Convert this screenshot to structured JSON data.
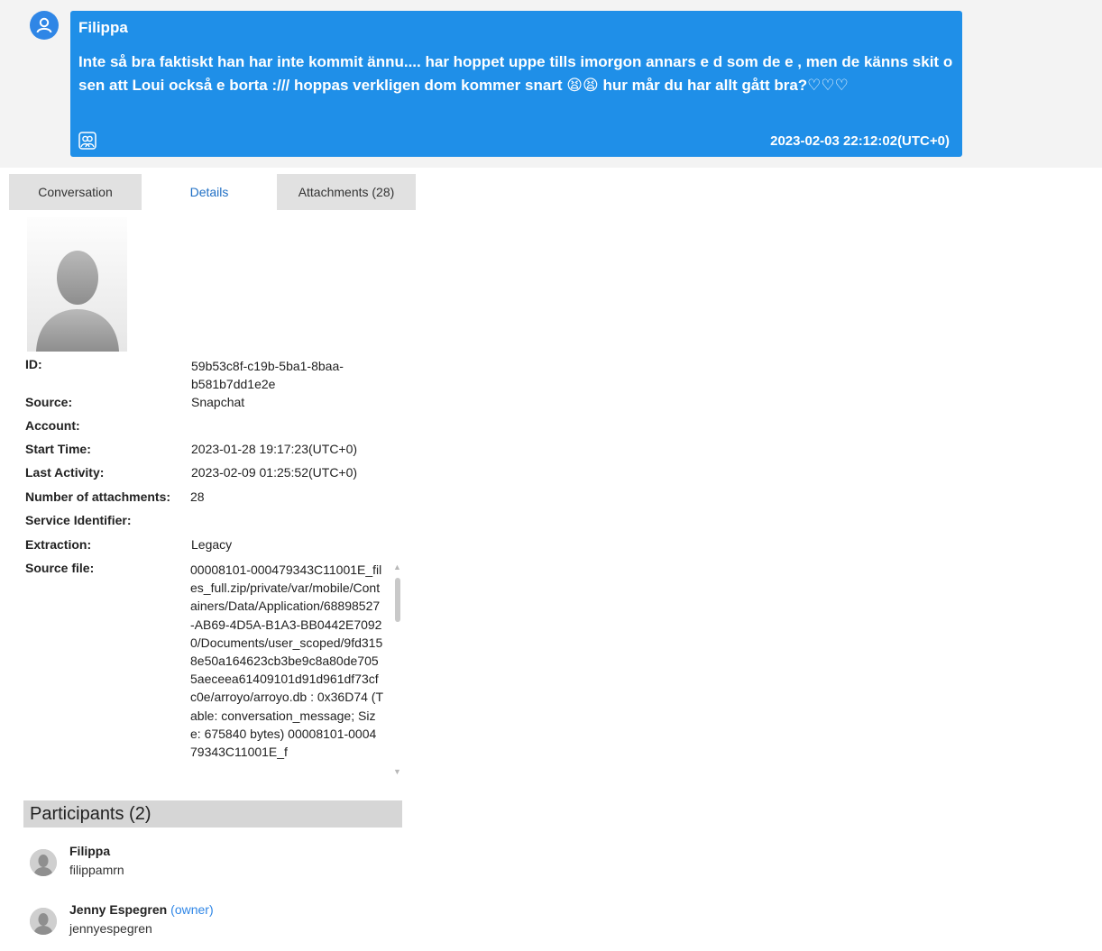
{
  "message": {
    "sender": "Filippa",
    "text": "Inte så bra faktiskt han har inte kommit ännu.... har hoppet uppe tills imorgon annars e d som de e , men de känns skit o sen att Loui också e borta :/// hoppas verkligen dom kommer snart 😫😫 hur mår du har allt gått bra?♡♡♡",
    "timestamp": "2023-02-03 22:12:02(UTC+0)"
  },
  "tabs": {
    "conversation": "Conversation",
    "details": "Details",
    "attachments": "Attachments (28)"
  },
  "details": {
    "id_label": "ID:",
    "id_value": "59b53c8f-c19b-5ba1-8baa-b581b7dd1e2e",
    "source_label": "Source:",
    "source_value": "Snapchat",
    "account_label": "Account:",
    "account_value": "",
    "start_label": "Start Time:",
    "start_value": "2023-01-28 19:17:23(UTC+0)",
    "last_label": "Last Activity:",
    "last_value": "2023-02-09 01:25:52(UTC+0)",
    "attachments_label": "Number of attachments:",
    "attachments_value": "28",
    "service_label": "Service Identifier:",
    "service_value": "",
    "extraction_label": "Extraction:",
    "extraction_value": "Legacy",
    "sourcefile_label": "Source file:",
    "sourcefile_value": "00008101-000479343C11001E_files_full.zip/private/var/mobile/Containers/Data/Application/68898527-AB69-4D5A-B1A3-BB0442E70920/Documents/user_scoped/9fd3158e50a164623cb3be9c8a80de7055aeceea61409101d91d961df73cfc0e/arroyo/arroyo.db : 0x36D74 (Table: conversation_message; Size: 675840 bytes) 00008101-000479343C11001E_f"
  },
  "participants": {
    "header": "Participants (2)",
    "items": [
      {
        "name": "Filippa",
        "username": "filippamrn",
        "owner": ""
      },
      {
        "name": "Jenny Espegren",
        "username": "jennyespegren",
        "owner": "(owner)"
      }
    ]
  },
  "colors": {
    "bubble": "#1f8fe8",
    "accent": "#2f86e6",
    "tab_inactive": "#e1e1e1",
    "section_header": "#d6d6d6"
  }
}
